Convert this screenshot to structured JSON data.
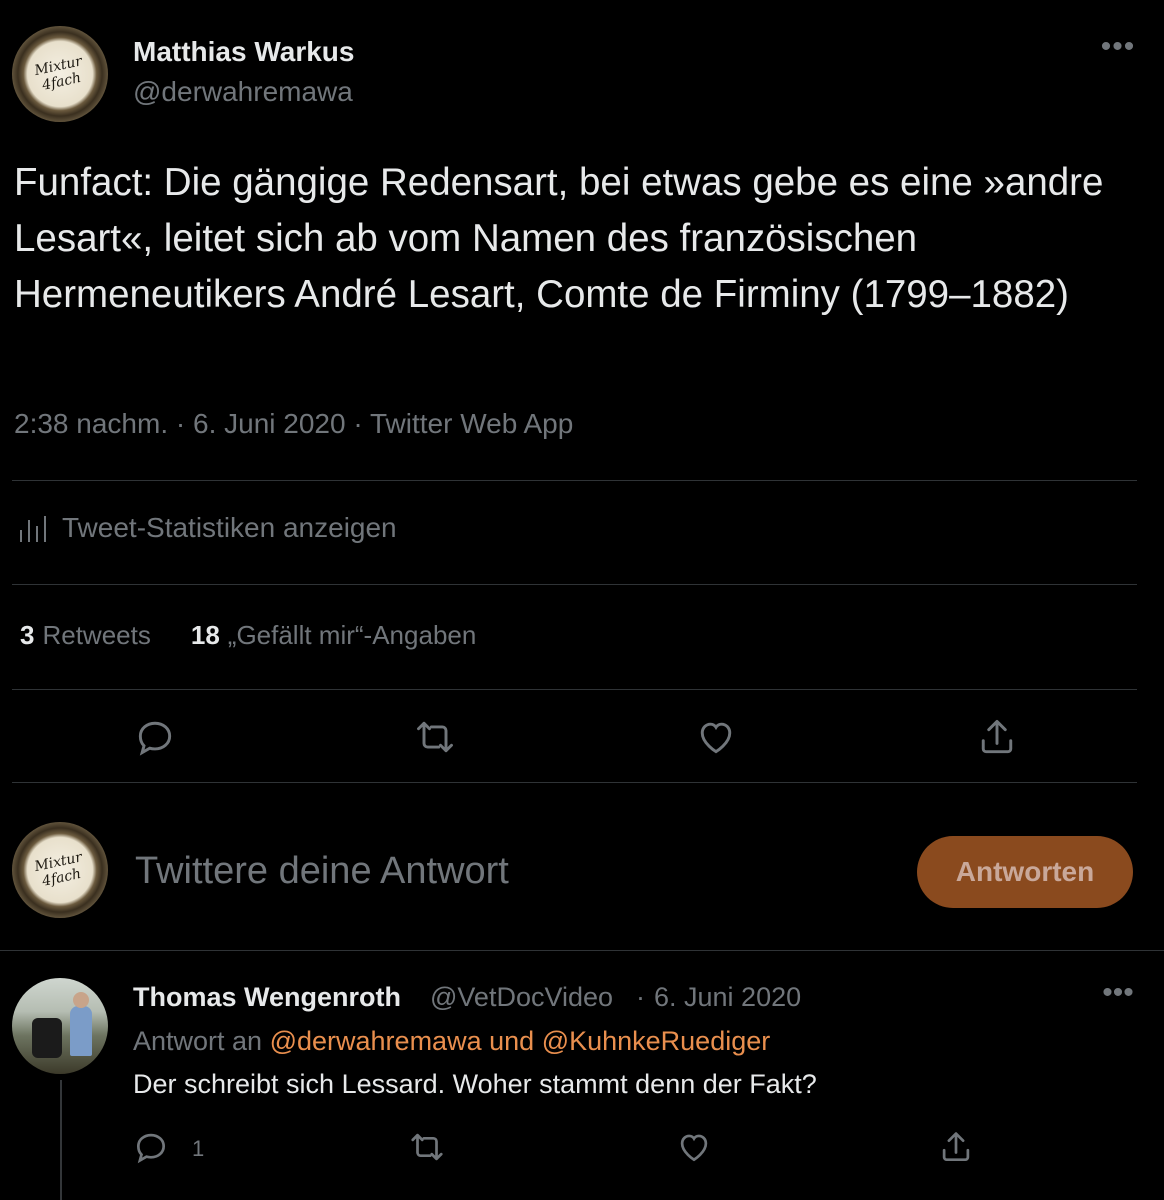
{
  "tweet": {
    "author_name": "Matthias Warkus",
    "author_handle": "@derwahremawa",
    "avatar_text_1": "Mixtur",
    "avatar_text_2": "4fach",
    "more_icon": "more-horizontal-icon",
    "text": "Funfact: Die gängige Redensart, bei etwas gebe es eine »andre Lesart«, leitet sich ab vom Namen des französischen Hermeneutikers André Lesart, Comte de Firminy (1799–1882)",
    "time": "2:38 nachm.",
    "date": "6. Juni 2020",
    "source": "Twitter Web App",
    "separator": "·",
    "stats_label": "Tweet-Statistiken anzeigen",
    "retweets_count": "3",
    "retweets_label": "Retweets",
    "likes_count": "18",
    "likes_label": "„Gefällt mir“-Angaben"
  },
  "composer": {
    "placeholder": "Twittere deine Antwort",
    "button_label": "Antworten"
  },
  "reply": {
    "author_name": "Thomas Wengenroth",
    "author_handle": "@VetDocVideo",
    "separator": "·",
    "date": "6. Juni 2020",
    "reply_to_prefix": "Antwort an",
    "mention_1": "@derwahremawa",
    "conjunction": "und",
    "mention_2": "@KuhnkeRuediger",
    "text": "Der schreibt sich Lessard. Woher stammt denn der Fakt?",
    "reply_count": "1"
  },
  "colors": {
    "background": "#000000",
    "text_primary": "#e7e9ea",
    "text_secondary": "#71767b",
    "accent": "#e98f4e",
    "button_bg": "#8a4a1e"
  }
}
